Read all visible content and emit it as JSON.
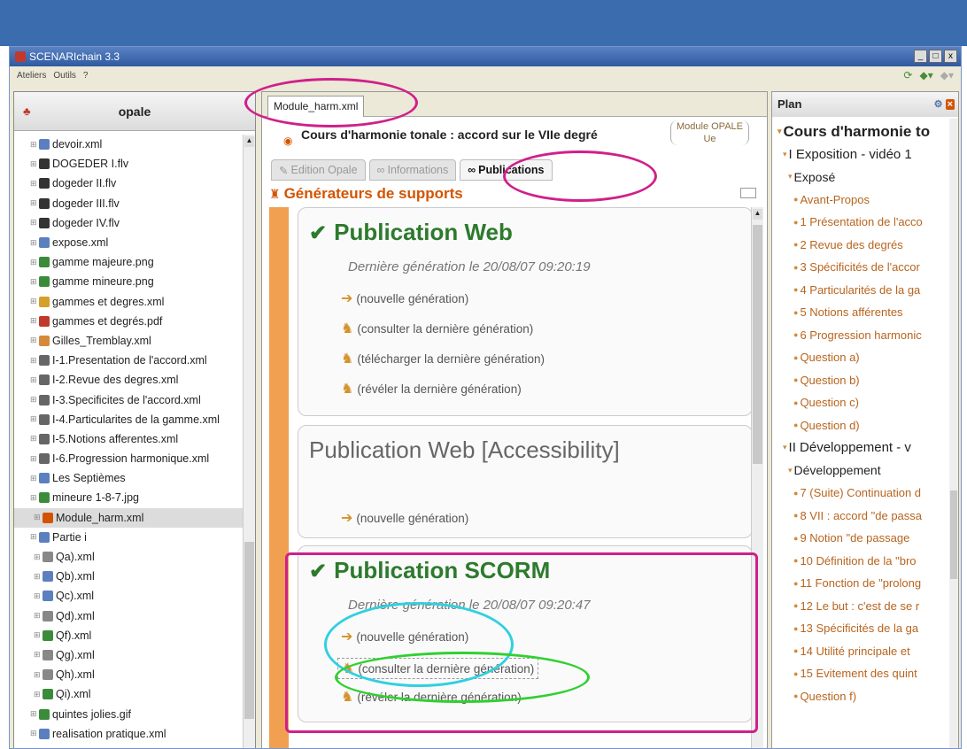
{
  "window": {
    "title": "SCENARIchain 3.3",
    "controls": [
      "_",
      "□",
      "x"
    ]
  },
  "menu": {
    "items": [
      "Ateliers",
      "Outils",
      "?"
    ]
  },
  "left_panel": {
    "title": "opale",
    "items": [
      {
        "label": "devoir.xml",
        "icon": "xml-icon",
        "color": "#5b7fbf"
      },
      {
        "label": "DOGEDER I.flv",
        "icon": "film-icon",
        "color": "#333333"
      },
      {
        "label": "dogeder II.flv",
        "icon": "film-icon",
        "color": "#333333"
      },
      {
        "label": "dogeder III.flv",
        "icon": "film-icon",
        "color": "#333333"
      },
      {
        "label": "dogeder IV.flv",
        "icon": "film-icon",
        "color": "#333333"
      },
      {
        "label": "expose.xml",
        "icon": "xml-icon",
        "color": "#5b7fbf"
      },
      {
        "label": "gamme majeure.png",
        "icon": "image-icon",
        "color": "#3a8c3a"
      },
      {
        "label": "gamme mineure.png",
        "icon": "image-icon",
        "color": "#3a8c3a"
      },
      {
        "label": "gammes et degres.xml",
        "icon": "xml-icon",
        "color": "#d4a02a"
      },
      {
        "label": "gammes et degrés.pdf",
        "icon": "pdf-icon",
        "color": "#c0392b"
      },
      {
        "label": "Gilles_Tremblay.xml",
        "icon": "xml-icon",
        "color": "#d48a3a"
      },
      {
        "label": "I-1.Presentation de l'accord.xml",
        "icon": "xml-icon",
        "color": "#666666"
      },
      {
        "label": "I-2.Revue des degres.xml",
        "icon": "xml-icon",
        "color": "#666666"
      },
      {
        "label": "I-3.Specificites de l'accord.xml",
        "icon": "xml-icon",
        "color": "#666666"
      },
      {
        "label": "I-4.Particularites de la gamme.xml",
        "icon": "xml-icon",
        "color": "#666666"
      },
      {
        "label": "I-5.Notions afferentes.xml",
        "icon": "xml-icon",
        "color": "#666666"
      },
      {
        "label": "I-6.Progression harmonique.xml",
        "icon": "xml-icon",
        "color": "#666666"
      },
      {
        "label": "Les Septièmes",
        "icon": "folder-icon",
        "color": "#5b7fbf"
      },
      {
        "label": "mineure 1-8-7.jpg",
        "icon": "image-icon",
        "color": "#3a8c3a"
      },
      {
        "label": "Module_harm.xml",
        "icon": "module-icon",
        "color": "#d35400",
        "selected": true
      },
      {
        "label": "Partie i",
        "icon": "folder-icon",
        "color": "#5b7fbf"
      },
      {
        "label": "Qa).xml",
        "icon": "xml-icon",
        "color": "#888888"
      },
      {
        "label": "Qb).xml",
        "icon": "xml-icon",
        "color": "#5b7fbf"
      },
      {
        "label": "Qc).xml",
        "icon": "xml-icon",
        "color": "#5b7fbf"
      },
      {
        "label": "Qd).xml",
        "icon": "xml-icon",
        "color": "#888888"
      },
      {
        "label": "Qf).xml",
        "icon": "xml-icon",
        "color": "#3a8c3a"
      },
      {
        "label": "Qg).xml",
        "icon": "xml-icon",
        "color": "#888888"
      },
      {
        "label": "Qh).xml",
        "icon": "xml-icon",
        "color": "#888888"
      },
      {
        "label": "Qi).xml",
        "icon": "xml-icon",
        "color": "#3a8c3a"
      },
      {
        "label": "quintes jolies.gif",
        "icon": "image-icon",
        "color": "#3a8c3a"
      },
      {
        "label": "realisation pratique.xml",
        "icon": "xml-icon",
        "color": "#5b7fbf"
      }
    ]
  },
  "editor": {
    "tab": "Module_harm.xml",
    "doc_title": "Cours d'harmonie tonale : accord sur le VIIe degré",
    "badge_line1": "Module OPALE",
    "badge_line2": "Ue",
    "subtabs": [
      "Edition Opale",
      "Informations",
      "Publications"
    ],
    "section_title": "Générateurs de supports",
    "publications": [
      {
        "title": "Publication Web",
        "checked": true,
        "last_gen": "Dernière génération le 20/08/07 09:20:19",
        "actions": [
          "(nouvelle génération)",
          "(consulter la dernière génération)",
          "(télécharger la dernière génération)",
          "(révéler la dernière génération)"
        ]
      },
      {
        "title": "Publication Web [Accessibility]",
        "checked": false,
        "last_gen": "",
        "actions": [
          "(nouvelle génération)"
        ]
      },
      {
        "title": "Publication SCORM",
        "checked": true,
        "last_gen": "Dernière génération le 20/08/07 09:20:47",
        "actions": [
          "(nouvelle génération)",
          "(consulter la dernière génération)",
          "(révéler la dernière génération)"
        ]
      }
    ]
  },
  "plan": {
    "title": "Plan",
    "items": [
      {
        "label": "Cours d'harmonie to",
        "level": 0
      },
      {
        "label": "I Exposition - vidéo 1",
        "level": 1
      },
      {
        "label": "Exposé",
        "level": 2
      },
      {
        "label": "Avant-Propos",
        "level": 3
      },
      {
        "label": "1 Présentation de l'acco",
        "level": 3
      },
      {
        "label": "2 Revue des degrés",
        "level": 3
      },
      {
        "label": "3 Spécificités de l'accor",
        "level": 3
      },
      {
        "label": "4 Particularités de la ga",
        "level": 3
      },
      {
        "label": "5 Notions afférentes",
        "level": 3
      },
      {
        "label": "6 Progression harmonic",
        "level": 3
      },
      {
        "label": "Question a)",
        "level": 3
      },
      {
        "label": "Question b)",
        "level": 3
      },
      {
        "label": "Question c)",
        "level": 3
      },
      {
        "label": "Question d)",
        "level": 3
      },
      {
        "label": "II Développement - v",
        "level": 1
      },
      {
        "label": "Développement",
        "level": 2
      },
      {
        "label": "7 (Suite) Continuation d",
        "level": 3
      },
      {
        "label": "8 VII : accord \"de passa",
        "level": 3
      },
      {
        "label": "9 Notion \"de passage",
        "level": 3
      },
      {
        "label": "10 Définition de la \"bro",
        "level": 3
      },
      {
        "label": "11 Fonction de \"prolong",
        "level": 3
      },
      {
        "label": "12 Le but : c'est de se r",
        "level": 3
      },
      {
        "label": "13 Spécificités de la ga",
        "level": 3
      },
      {
        "label": "14 Utilité principale et",
        "level": 3
      },
      {
        "label": "15 Evitement des quint",
        "level": 3
      },
      {
        "label": "Question f)",
        "level": 3
      }
    ]
  },
  "colors": {
    "topbar": "#3a6cae",
    "accent_orange": "#d35400",
    "check_green": "#2d7a2d",
    "annotation_magenta": "#d0208a",
    "annotation_cyan": "#30d0e0",
    "annotation_green": "#30d030"
  }
}
